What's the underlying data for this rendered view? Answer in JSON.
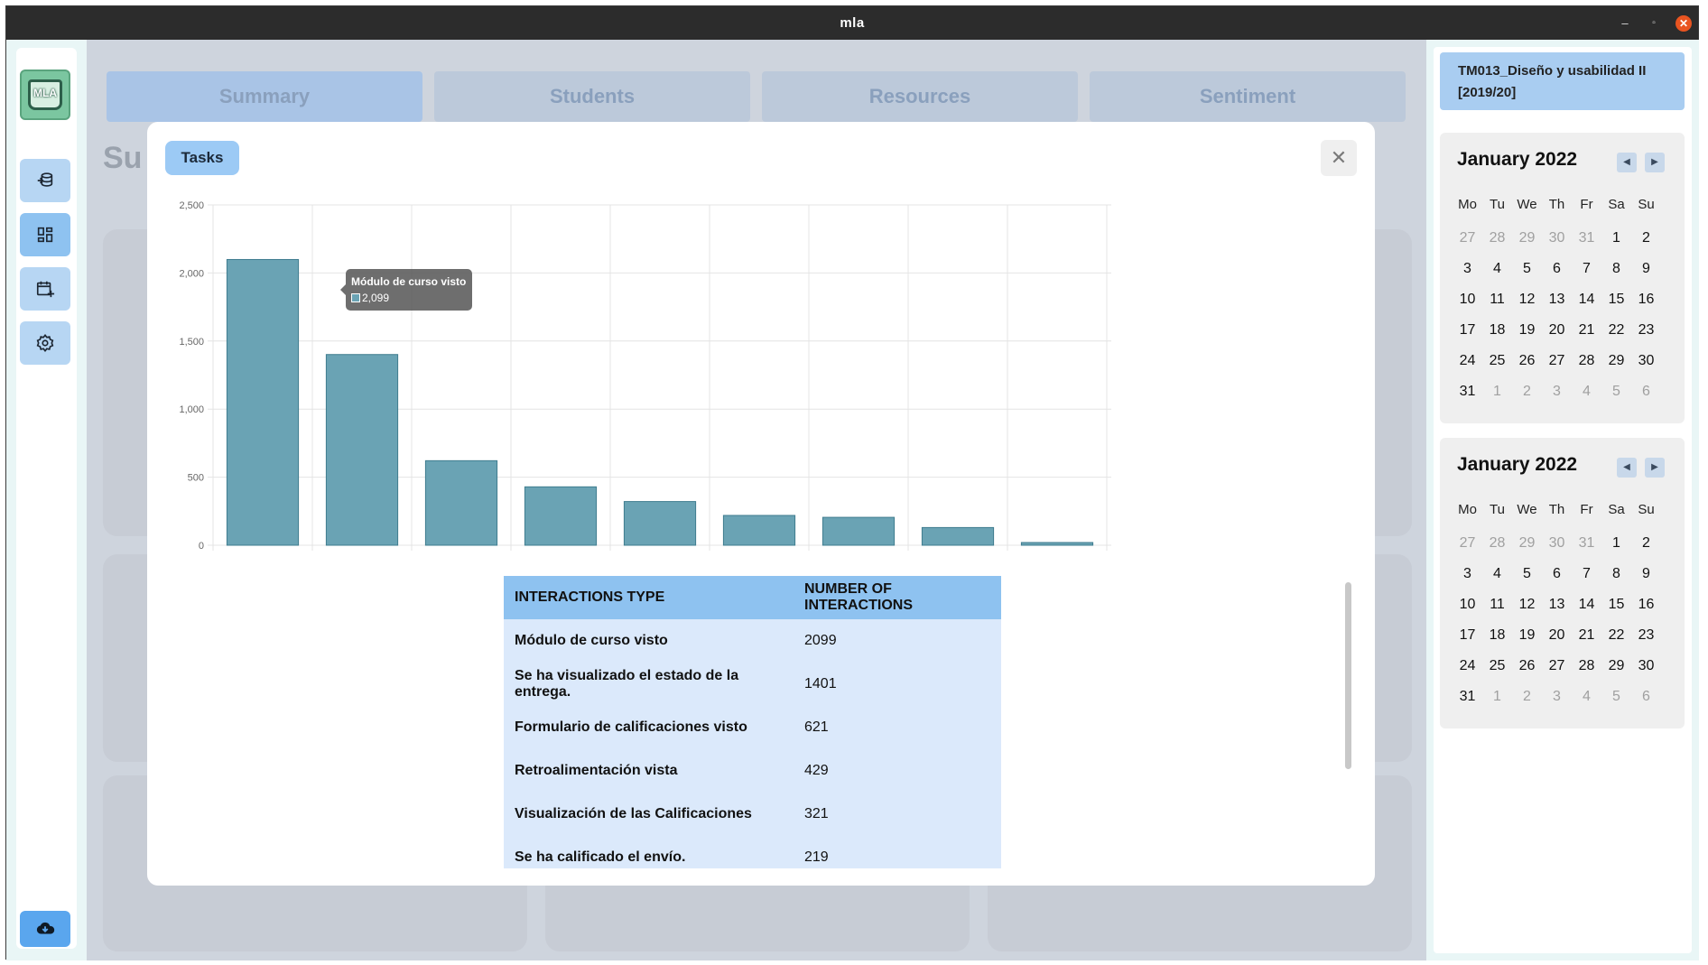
{
  "window": {
    "title": "mla",
    "controls": {
      "minimize": "–",
      "maximize": "▫",
      "close": "✕"
    }
  },
  "sidebar": {
    "logo_text": "MLA",
    "items": [
      {
        "icon": "database-icon"
      },
      {
        "icon": "dashboard-icon"
      },
      {
        "icon": "calendar-add-icon"
      },
      {
        "icon": "settings-icon"
      }
    ],
    "bottom_icon": "cloud-download-icon"
  },
  "background": {
    "tabs": [
      "Summary",
      "Students",
      "Resources",
      "Sentiment"
    ],
    "page_title": "Su"
  },
  "course": {
    "name": "TM013_Diseño y usabilidad II [2019/20]"
  },
  "calendars": [
    {
      "month": "January 2022",
      "weekdays": [
        "Mo",
        "Tu",
        "We",
        "Th",
        "Fr",
        "Sa",
        "Su"
      ],
      "weeks": [
        [
          "27",
          "28",
          "29",
          "30",
          "31",
          "1",
          "2"
        ],
        [
          "3",
          "4",
          "5",
          "6",
          "7",
          "8",
          "9"
        ],
        [
          "10",
          "11",
          "12",
          "13",
          "14",
          "15",
          "16"
        ],
        [
          "17",
          "18",
          "19",
          "20",
          "21",
          "22",
          "23"
        ],
        [
          "24",
          "25",
          "26",
          "27",
          "28",
          "29",
          "30"
        ],
        [
          "31",
          "1",
          "2",
          "3",
          "4",
          "5",
          "6"
        ]
      ]
    },
    {
      "month": "January 2022",
      "weekdays": [
        "Mo",
        "Tu",
        "We",
        "Th",
        "Fr",
        "Sa",
        "Su"
      ],
      "weeks": [
        [
          "27",
          "28",
          "29",
          "30",
          "31",
          "1",
          "2"
        ],
        [
          "3",
          "4",
          "5",
          "6",
          "7",
          "8",
          "9"
        ],
        [
          "10",
          "11",
          "12",
          "13",
          "14",
          "15",
          "16"
        ],
        [
          "17",
          "18",
          "19",
          "20",
          "21",
          "22",
          "23"
        ],
        [
          "24",
          "25",
          "26",
          "27",
          "28",
          "29",
          "30"
        ],
        [
          "31",
          "1",
          "2",
          "3",
          "4",
          "5",
          "6"
        ]
      ]
    }
  ],
  "modal": {
    "tab_label": "Tasks",
    "close_symbol": "✕",
    "tooltip": {
      "title": "Módulo de curso visto",
      "value": "2,099"
    }
  },
  "chart_data": {
    "type": "bar",
    "ylim": [
      0,
      2500
    ],
    "yticks": [
      "0",
      "500",
      "1,000",
      "1,500",
      "2,000",
      "2,500"
    ],
    "values": [
      2099,
      1401,
      621,
      429,
      321,
      219,
      205,
      130,
      20
    ],
    "bar_color": "#6aa3b4",
    "bar_edge_color": "#3f7c8f",
    "grid": true
  },
  "table": {
    "headers": [
      "INTERACTIONS TYPE",
      "NUMBER OF INTERACTIONS"
    ],
    "rows": [
      [
        "Módulo de curso visto",
        "2099"
      ],
      [
        "Se ha visualizado el estado de la entrega.",
        "1401"
      ],
      [
        "Formulario de calificaciones visto",
        "621"
      ],
      [
        "Retroalimentación vista",
        "429"
      ],
      [
        "Visualización de las Calificaciones",
        "321"
      ],
      [
        "Se ha calificado el envío.",
        "219"
      ]
    ]
  }
}
